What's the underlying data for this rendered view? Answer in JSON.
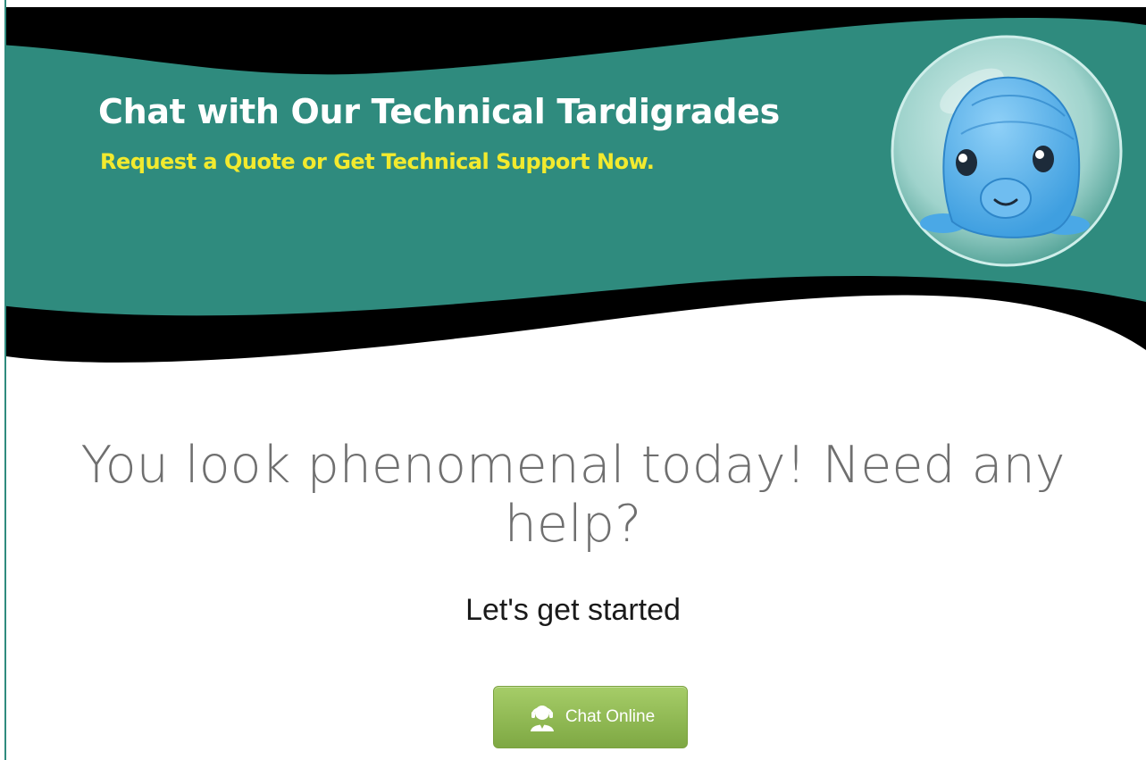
{
  "banner": {
    "title": "Chat with Our Technical Tardigrades",
    "subtitle": "Request a Quote or Get Technical Support Now.",
    "mascot_icon": "tardigrade-mascot",
    "colors": {
      "teal": "#2f8b7e",
      "black": "#000000",
      "title": "#ffffff",
      "subtitle": "#f2ea2e"
    }
  },
  "main": {
    "headline": "You look phenomenal today! Need any help?",
    "subhead": "Let's get started"
  },
  "chat_button": {
    "label": "Chat Online",
    "icon": "support-agent-icon",
    "color": "#8fb84f"
  }
}
